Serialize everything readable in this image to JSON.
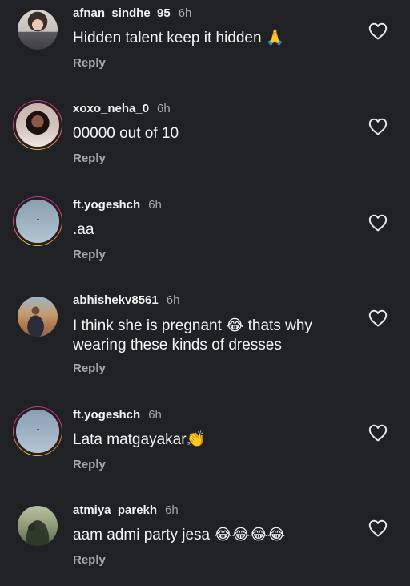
{
  "comments": [
    {
      "username": "afnan_sindhe_95",
      "time": "6h",
      "text": "Hidden talent keep it hidden 🙏",
      "reply": "Reply",
      "avatar": "afnan"
    },
    {
      "username": "xoxo_neha_0",
      "time": "6h",
      "text": "00000 out of 10",
      "reply": "Reply",
      "avatar": "neha"
    },
    {
      "username": "ft.yogeshch",
      "time": "6h",
      "text": ".aa",
      "reply": "Reply",
      "avatar": "sky"
    },
    {
      "username": "abhishekv8561",
      "time": "6h",
      "text": "I think she is pregnant 😂 thats why wearing these kinds of dresses",
      "reply": "Reply",
      "avatar": "abhi"
    },
    {
      "username": "ft.yogeshch",
      "time": "6h",
      "text": "Lata matgayakar👏",
      "reply": "Reply",
      "avatar": "sky"
    },
    {
      "username": "atmiya_parekh",
      "time": "6h",
      "text": "aam admi party jesa 😂😂😂😂",
      "reply": "Reply",
      "avatar": "atmiya"
    }
  ],
  "icons": {
    "like": "heart-outline-icon"
  },
  "colors": {
    "background": "#202124",
    "secondary_text": "#a8a8a8",
    "primary_text": "#f5f5f5"
  }
}
